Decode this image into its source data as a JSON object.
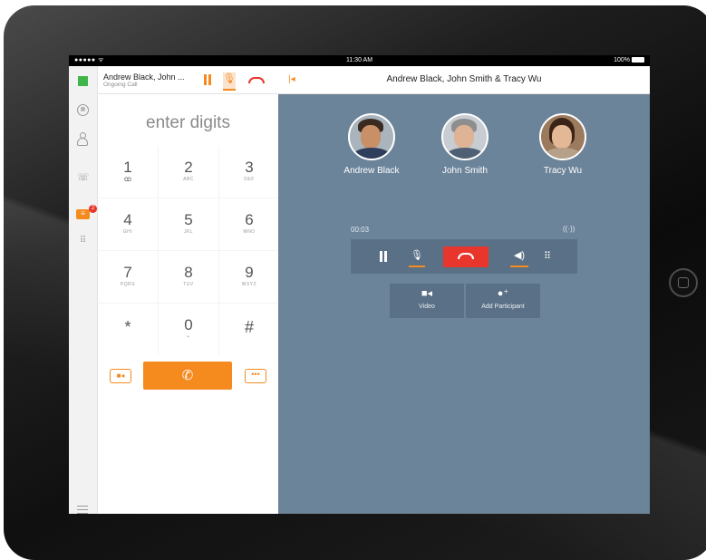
{
  "status_bar": {
    "signal": "●●●●● ᯤ",
    "time": "11:30 AM",
    "battery": "100%"
  },
  "call_header": {
    "name": "Andrew Black, John ...",
    "status": "Ongoing Call"
  },
  "rail": {
    "messages_badge": "2"
  },
  "dialpad": {
    "placeholder": "enter digits",
    "keys": [
      {
        "digit": "1",
        "letters": "ꝏ"
      },
      {
        "digit": "2",
        "letters": "ABC"
      },
      {
        "digit": "3",
        "letters": "DEF"
      },
      {
        "digit": "4",
        "letters": "GHI"
      },
      {
        "digit": "5",
        "letters": "JKL"
      },
      {
        "digit": "6",
        "letters": "MNO"
      },
      {
        "digit": "7",
        "letters": "PQRS"
      },
      {
        "digit": "8",
        "letters": "TUV"
      },
      {
        "digit": "9",
        "letters": "WXYZ"
      },
      {
        "digit": "*",
        "letters": ""
      },
      {
        "digit": "0",
        "letters": "+"
      },
      {
        "digit": "#",
        "letters": ""
      }
    ]
  },
  "conference": {
    "title": "Andrew Black, John Smith & Tracy Wu",
    "participants": [
      {
        "name": "Andrew Black"
      },
      {
        "name": "John Smith"
      },
      {
        "name": "Tracy Wu"
      }
    ],
    "duration": "00:03",
    "video_label": "Video",
    "add_participant_label": "Add Participant"
  },
  "colors": {
    "accent": "#f58a1f",
    "end_call": "#e8362d",
    "presence": "#3fb549",
    "conference_bg": "#6c849a"
  }
}
